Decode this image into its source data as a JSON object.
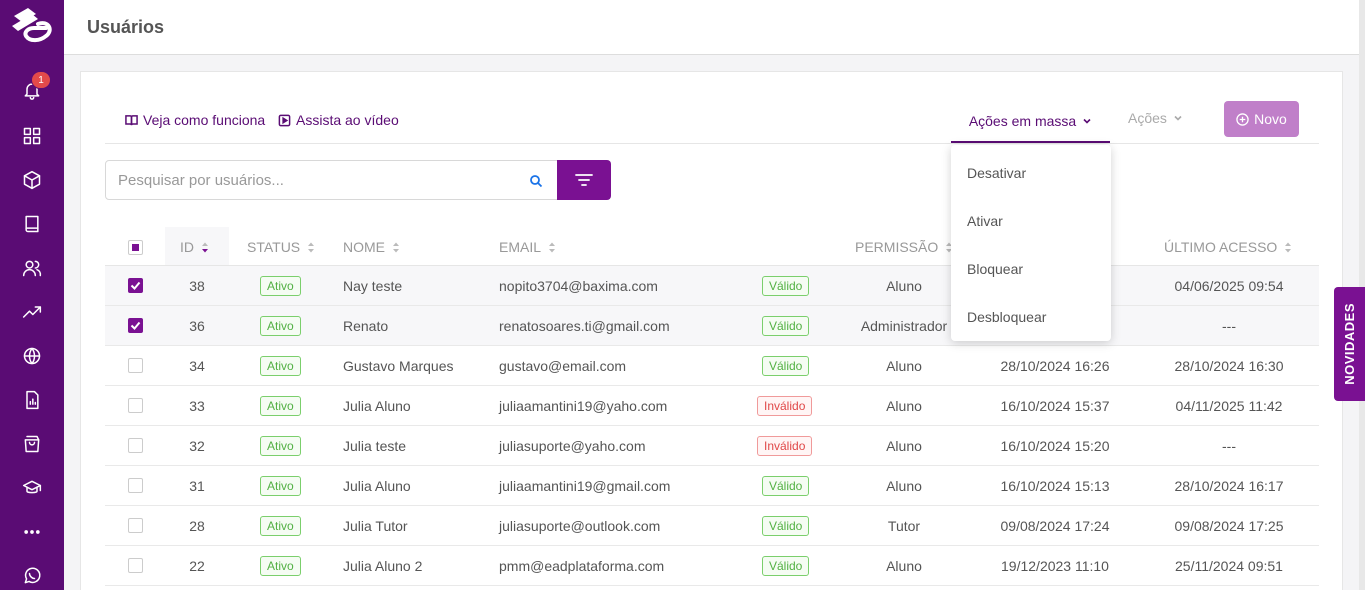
{
  "page_title": "Usuários",
  "notifications_count": "1",
  "help_links": {
    "how_it_works": "Veja como funciona",
    "watch_video": "Assista ao vídeo"
  },
  "toolbar": {
    "mass_actions": "Ações em massa",
    "actions": "Ações",
    "new": "Novo"
  },
  "search": {
    "placeholder": "Pesquisar por usuários...",
    "value": ""
  },
  "mass_actions_menu": [
    "Desativar",
    "Ativar",
    "Bloquear",
    "Desbloquear"
  ],
  "table": {
    "headers": {
      "id": "ID",
      "status": "STATUS",
      "name": "NOME",
      "email": "EMAIL",
      "permission": "PERMISSÃO",
      "last_access": "ÚLTIMO ACESSO"
    },
    "rows": [
      {
        "checked": true,
        "id": "38",
        "status": "Ativo",
        "name": "Nay teste",
        "email": "nopito3704@baxima.com",
        "validity": "Válido",
        "valid": true,
        "permission": "Aluno",
        "created": "",
        "last_access": "04/06/2025 09:54"
      },
      {
        "checked": true,
        "id": "36",
        "status": "Ativo",
        "name": "Renato",
        "email": "renatosoares.ti@gmail.com",
        "validity": "Válido",
        "valid": true,
        "permission": "Administrador",
        "created": "",
        "last_access": "---"
      },
      {
        "checked": false,
        "id": "34",
        "status": "Ativo",
        "name": "Gustavo Marques",
        "email": "gustavo@email.com",
        "validity": "Válido",
        "valid": true,
        "permission": "Aluno",
        "created": "28/10/2024 16:26",
        "last_access": "28/10/2024 16:30"
      },
      {
        "checked": false,
        "id": "33",
        "status": "Ativo",
        "name": "Julia Aluno",
        "email": "juliaamantini19@yaho.com",
        "validity": "Inválido",
        "valid": false,
        "permission": "Aluno",
        "created": "16/10/2024 15:37",
        "last_access": "04/11/2025 11:42"
      },
      {
        "checked": false,
        "id": "32",
        "status": "Ativo",
        "name": "Julia teste",
        "email": "juliasuporte@yaho.com",
        "validity": "Inválido",
        "valid": false,
        "permission": "Aluno",
        "created": "16/10/2024 15:20",
        "last_access": "---"
      },
      {
        "checked": false,
        "id": "31",
        "status": "Ativo",
        "name": "Julia Aluno",
        "email": "juliaamantini19@gmail.com",
        "validity": "Válido",
        "valid": true,
        "permission": "Aluno",
        "created": "16/10/2024 15:13",
        "last_access": "28/10/2024 16:17"
      },
      {
        "checked": false,
        "id": "28",
        "status": "Ativo",
        "name": "Julia Tutor",
        "email": "juliasuporte@outlook.com",
        "validity": "Válido",
        "valid": true,
        "permission": "Tutor",
        "created": "09/08/2024 17:24",
        "last_access": "09/08/2024 17:25"
      },
      {
        "checked": false,
        "id": "22",
        "status": "Ativo",
        "name": "Julia Aluno 2",
        "email": "pmm@eadplataforma.com",
        "validity": "Válido",
        "valid": true,
        "permission": "Aluno",
        "created": "19/12/2023 11:10",
        "last_access": "25/11/2024 09:51"
      }
    ]
  },
  "novidades": "NOVIDADES",
  "colors": {
    "brand": "#5a0c74",
    "accent": "#7a1192",
    "button_disabled": "#c07fc9",
    "valid": "#52b043",
    "invalid": "#e04848"
  },
  "sidebar_icons": [
    "bell-icon",
    "grid-icon",
    "cube-icon",
    "book-icon",
    "users-icon",
    "trend-icon",
    "globe-icon",
    "report-icon",
    "bag-icon",
    "graduation-icon",
    "more-icon",
    "whatsapp-icon"
  ]
}
